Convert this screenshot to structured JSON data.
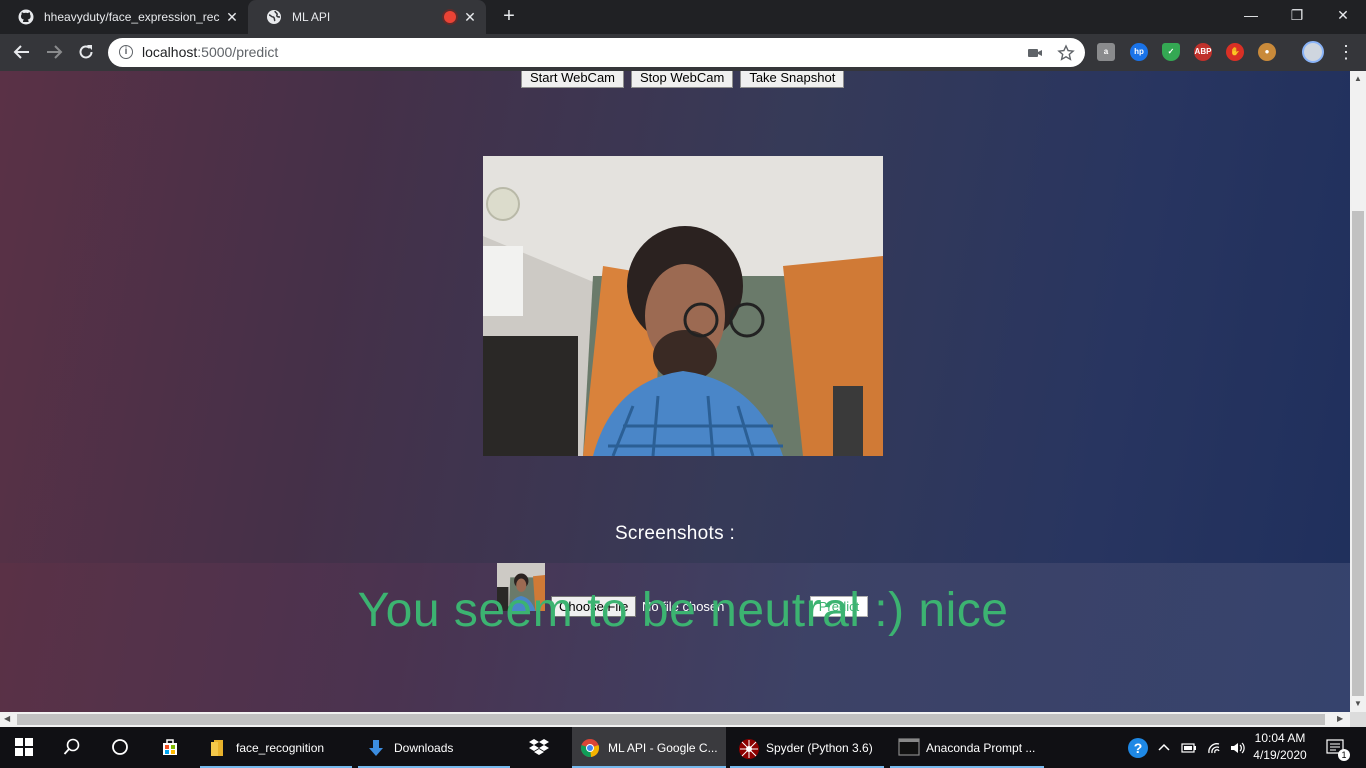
{
  "browser": {
    "tabs": [
      {
        "title": "hheavyduty/face_expression_recognition",
        "icon": "github-icon",
        "active": false
      },
      {
        "title": "ML API",
        "icon": "globe-icon",
        "active": true
      }
    ],
    "address": {
      "host": "localhost",
      "rest": ":5000/predict"
    }
  },
  "page": {
    "buttons": {
      "start": "Start WebCam",
      "stop": "Stop WebCam",
      "snapshot": "Take Snapshot"
    },
    "screenshots_label": "Screenshots :",
    "file_input": {
      "button": "Choose File",
      "status": "No file chosen"
    },
    "predict_label": "Predict",
    "result_text": "You seem to be neutral :) nice",
    "result_color": "#3cb371"
  },
  "taskbar": {
    "apps": [
      {
        "label": "face_recognition",
        "icon": "folder-icon"
      },
      {
        "label": "Downloads",
        "icon": "download-icon"
      },
      {
        "label": "",
        "icon": "dropbox-icon"
      },
      {
        "label": "ML API - Google C...",
        "icon": "chrome-icon"
      },
      {
        "label": "Spyder (Python 3.6)",
        "icon": "spyder-icon"
      },
      {
        "label": "Anaconda Prompt ...",
        "icon": "terminal-icon"
      }
    ],
    "clock": {
      "time": "10:04 AM",
      "date": "4/19/2020"
    },
    "notification_count": "1"
  }
}
